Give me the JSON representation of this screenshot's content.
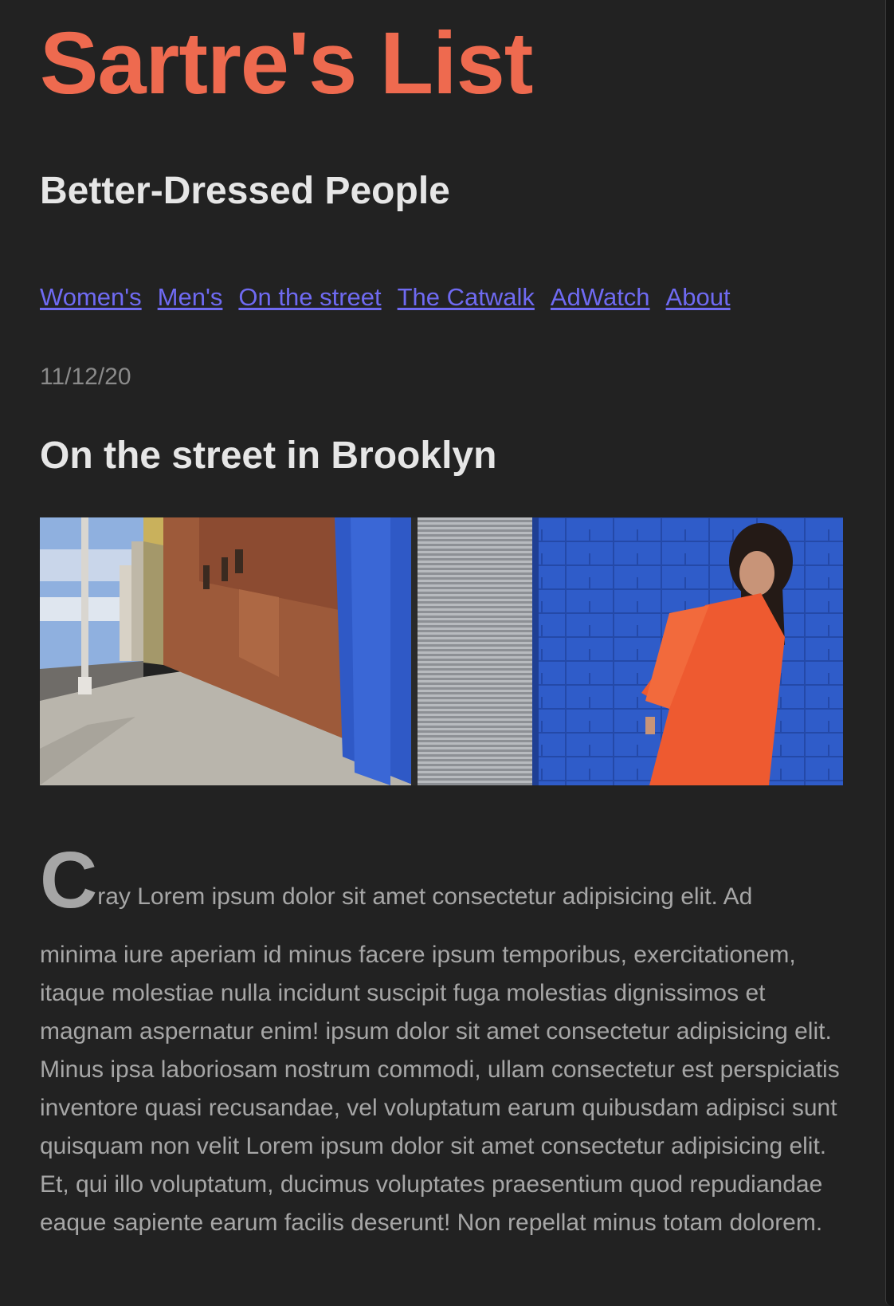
{
  "site": {
    "title": "Sartre's List",
    "tagline": "Better-Dressed People"
  },
  "nav": {
    "items": [
      {
        "label": "Women's"
      },
      {
        "label": "Men's"
      },
      {
        "label": "On the street"
      },
      {
        "label": "The Catwalk"
      },
      {
        "label": "AdWatch"
      },
      {
        "label": "About"
      }
    ]
  },
  "post": {
    "date": "11/12/20",
    "title": "On the street in Brooklyn",
    "drop_cap": "C",
    "lede_rest": "ray Lorem ipsum dolor sit amet consectetur adipisicing elit. Ad",
    "body": "minima iure aperiam id minus facere ipsum temporibus, exercitationem, itaque molestiae nulla incidunt suscipit fuga molestias dignissimos et magnam aspernatur enim! ipsum dolor sit amet consectetur adipisicing elit. Minus ipsa laboriosam nostrum commodi, ullam consectetur est perspiciatis inventore quasi recusandae, vel voluptatum earum quibusdam adipisci sunt quisquam non velit Lorem ipsum dolor sit amet consectetur adipisicing elit. Et, qui illo voluptatum, ducimus voluptates praesentium quod repudiandae eaque sapiente earum facilis deserunt! Non repellat minus totam dolorem."
  },
  "colors": {
    "background": "#222222",
    "title": "#ee6a4f",
    "heading": "#e6e6e6",
    "link": "#6f6af2",
    "muted": "#8a8a8a",
    "body": "#a6a6a6"
  }
}
